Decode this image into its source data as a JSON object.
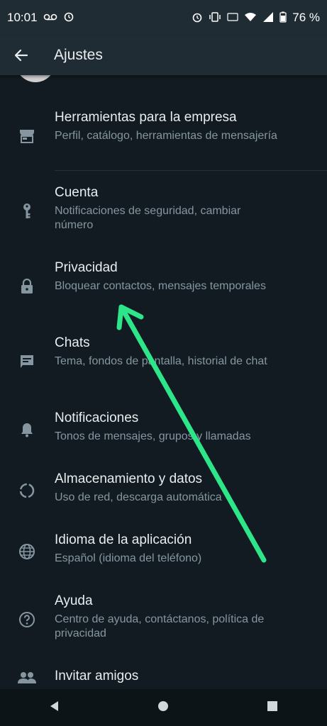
{
  "status": {
    "time": "10:01",
    "battery": "76 %"
  },
  "header": {
    "title": "Ajustes"
  },
  "settings": [
    {
      "label": "Herramientas para la empresa",
      "sub": "Perfil, catálogo, herramientas de mensajería",
      "icon": "store-icon"
    },
    {
      "label": "Cuenta",
      "sub": "Notificaciones de seguridad, cambiar número",
      "icon": "key-icon"
    },
    {
      "label": "Privacidad",
      "sub": "Bloquear contactos, mensajes temporales",
      "icon": "lock-icon"
    },
    {
      "label": "Chats",
      "sub": "Tema, fondos de pantalla, historial de chat",
      "icon": "chat-icon"
    },
    {
      "label": "Notificaciones",
      "sub": "Tonos de mensajes, grupos y llamadas",
      "icon": "bell-icon"
    },
    {
      "label": "Almacenamiento y datos",
      "sub": "Uso de red, descarga automática",
      "icon": "storage-icon"
    },
    {
      "label": "Idioma de la aplicación",
      "sub": "Español (idioma del teléfono)",
      "icon": "globe-icon"
    },
    {
      "label": "Ayuda",
      "sub": "Centro de ayuda, contáctanos, política de privacidad",
      "icon": "help-icon"
    },
    {
      "label": "Invitar amigos",
      "sub": "",
      "icon": "people-icon"
    }
  ],
  "colors": {
    "background": "#121b22",
    "appbar": "#1f2c34",
    "accent_arrow": "#2ee68a",
    "subtext": "#8696a0"
  }
}
